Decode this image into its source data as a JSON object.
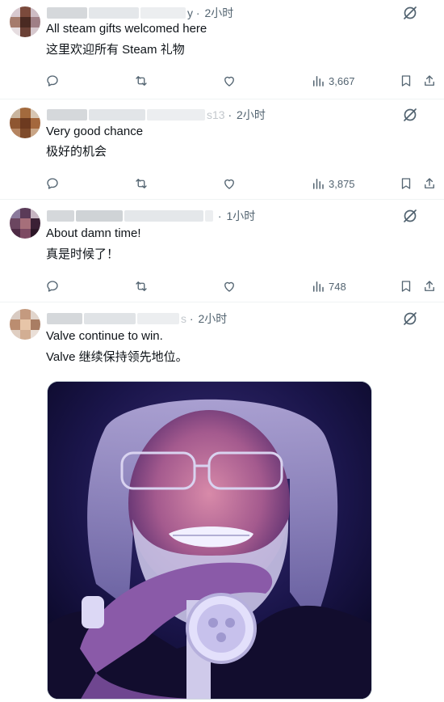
{
  "posts": [
    {
      "time": "2小时",
      "name_fragment": "y",
      "text_en": "All steam gifts welcomed here",
      "text_zh": "这里欢迎所有 Steam 礼物",
      "views": "3,667"
    },
    {
      "time": "2小时",
      "name_fragment": "s13",
      "text_en": "Very good chance",
      "text_zh": "极好的机会",
      "views": "3,875"
    },
    {
      "time": "1小时",
      "name_fragment": "",
      "text_en": "About damn time!",
      "text_zh": "真是时候了！",
      "views": "748"
    },
    {
      "time": "2小时",
      "name_fragment": "s",
      "text_en": "Valve continue to win.",
      "text_zh": "Valve 继续保持领先地位。",
      "views": ""
    }
  ],
  "colors": {
    "icon_gray": "#536471",
    "text": "#0f1419",
    "divider": "#eff3f4"
  },
  "icons": [
    "reply-icon",
    "repost-icon",
    "like-icon",
    "views-icon",
    "bookmark-icon",
    "share-icon",
    "grok-icon"
  ]
}
